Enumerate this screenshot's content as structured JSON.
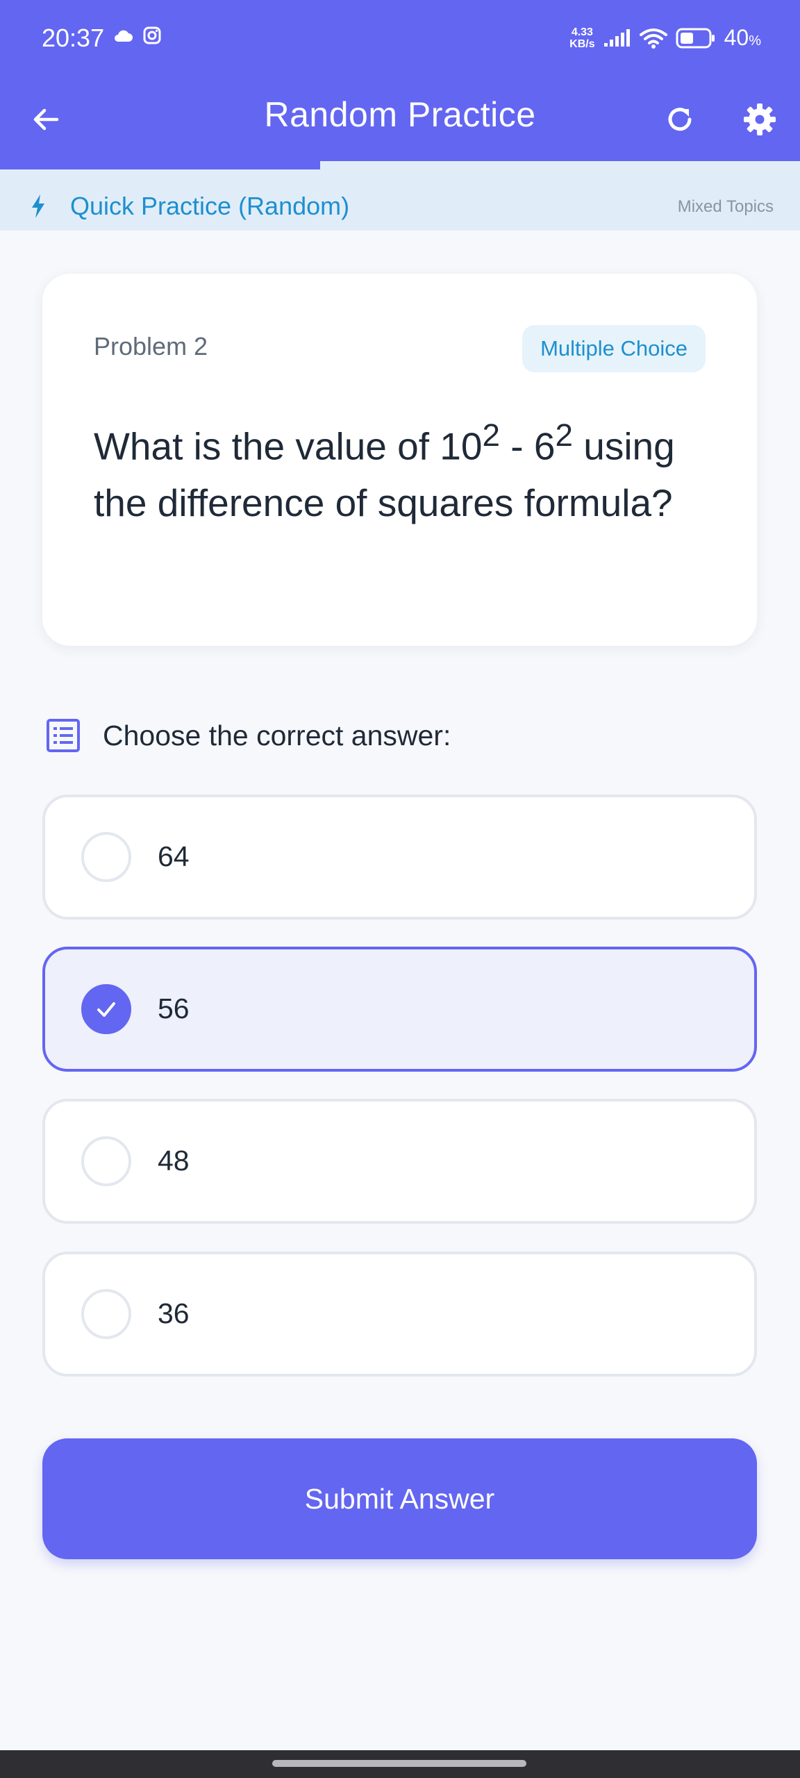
{
  "status_bar": {
    "time": "20:37",
    "net_speed_value": "4.33",
    "net_speed_unit": "KB/s",
    "battery_percent": "40",
    "battery_unit": "%",
    "icons": [
      "cloud-icon",
      "instagram-icon",
      "signal-icon",
      "wifi-icon",
      "battery-icon"
    ]
  },
  "app_bar": {
    "title": "Random Practice",
    "back_icon": "arrow-left-icon",
    "refresh_icon": "refresh-icon",
    "settings_icon": "gear-icon"
  },
  "progress": {
    "fraction": 0.4
  },
  "mode_banner": {
    "label": "Quick Practice (Random)",
    "topics": "Mixed Topics",
    "icon": "lightning-icon"
  },
  "problem": {
    "number_label": "Problem 2",
    "type_badge": "Multiple Choice",
    "question": {
      "part1": "What is the value of 10",
      "sup1": "2",
      "part2": " - 6",
      "sup2": "2",
      "part3": " using the difference of squares formula?"
    }
  },
  "answers": {
    "prompt": "Choose the correct answer:",
    "prompt_icon": "list-icon",
    "options": [
      {
        "label": "64",
        "selected": false
      },
      {
        "label": "56",
        "selected": true
      },
      {
        "label": "48",
        "selected": false
      },
      {
        "label": "36",
        "selected": false
      }
    ]
  },
  "submit": {
    "label": "Submit Answer"
  },
  "colors": {
    "primary": "#6366f1",
    "banner_bg": "#e0edf8",
    "accent_blue": "#1d8fcf",
    "page_bg": "#f7f8fb"
  }
}
